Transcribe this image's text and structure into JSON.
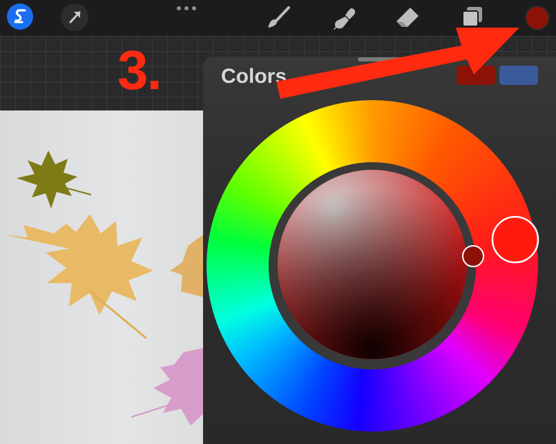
{
  "toolbar": {
    "left_icons": [
      "procreate-logo-icon",
      "arrow-transform-icon"
    ],
    "more_icon": "more-dots-icon",
    "tools": [
      "brush-icon",
      "smudge-icon",
      "eraser-icon",
      "layers-icon"
    ],
    "current_color": "#8c1208"
  },
  "annotation": {
    "step": "3.",
    "arrow_color": "#ff2a10"
  },
  "colors_panel": {
    "title": "Colors",
    "primary_color": "#8c1208",
    "secondary_color": "#3a5a9c",
    "wheel": {
      "hue_selector_color": "#ff1a10",
      "shade_selector_color": "#8c1208"
    }
  }
}
